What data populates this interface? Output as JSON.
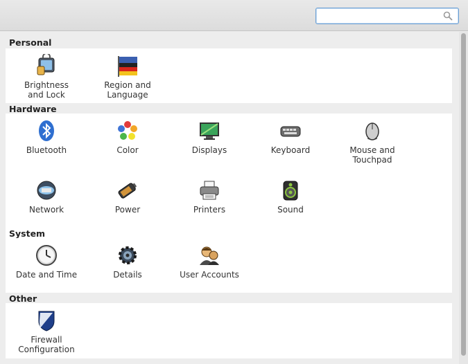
{
  "search": {
    "value": "",
    "placeholder": ""
  },
  "sections": {
    "personal": {
      "title": "Personal",
      "items": [
        {
          "label": "Brightness\nand Lock"
        },
        {
          "label": "Region and\nLanguage"
        }
      ]
    },
    "hardware": {
      "title": "Hardware",
      "items": [
        {
          "label": "Bluetooth"
        },
        {
          "label": "Color"
        },
        {
          "label": "Displays"
        },
        {
          "label": "Keyboard"
        },
        {
          "label": "Mouse and\nTouchpad"
        },
        {
          "label": "Network"
        },
        {
          "label": "Power"
        },
        {
          "label": "Printers"
        },
        {
          "label": "Sound"
        }
      ]
    },
    "system": {
      "title": "System",
      "items": [
        {
          "label": "Date and Time"
        },
        {
          "label": "Details"
        },
        {
          "label": "User Accounts"
        }
      ]
    },
    "other": {
      "title": "Other",
      "items": [
        {
          "label": "Firewall\nConfiguration"
        }
      ]
    }
  }
}
